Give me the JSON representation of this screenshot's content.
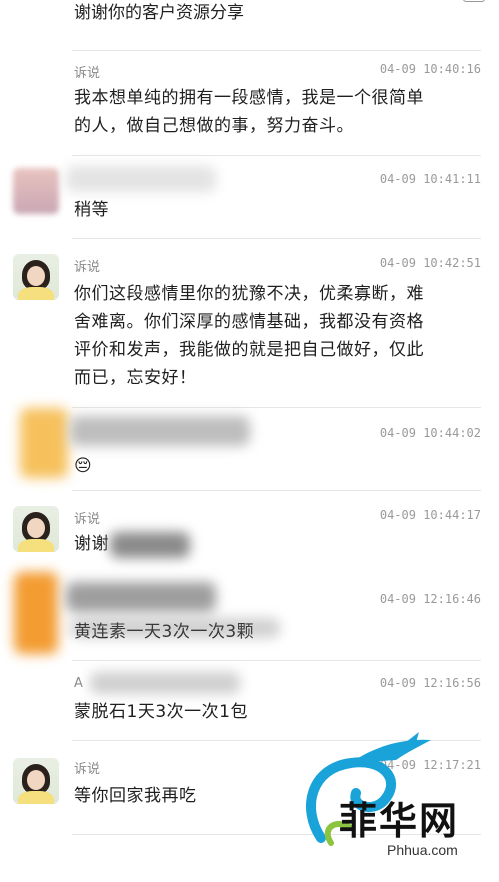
{
  "top_partial_text": "谢谢你的客户资源分享",
  "messages": [
    {
      "name": "诉说",
      "time": "04-09 10:40:16",
      "lines": [
        "我本想单纯的拥有一段感情，我是一个很简单",
        "的人，做自己想做的事，努力奋斗。"
      ]
    },
    {
      "name": "",
      "time": "04-09 10:41:11",
      "lines": [
        "稍等"
      ]
    },
    {
      "name": "诉说",
      "time": "04-09 10:42:51",
      "lines": [
        "你们这段感情里你的犹豫不决，优柔寡断，难",
        "舍难离。你们深厚的感情基础，我都没有资格",
        "评价和发声，我能做的就是把自己做好，仅此",
        "而已，忘安好！"
      ]
    },
    {
      "name": "",
      "time": "04-09 10:44:02",
      "lines": [
        "😔"
      ]
    },
    {
      "name": "诉说",
      "time": "04-09 10:44:17",
      "lines": [
        "谢谢"
      ]
    },
    {
      "name": "",
      "time": "04-09 12:16:46",
      "lines": [
        "黄连素一天3次一次3颗"
      ]
    },
    {
      "name": "A",
      "time": "04-09 12:16:56",
      "lines": [
        "蒙脱石1天3次一次1包"
      ]
    },
    {
      "name": "诉说",
      "time": "04-09 12:17:21",
      "lines": [
        "等你回家我再吃"
      ]
    }
  ],
  "watermark": {
    "title": "菲华网",
    "domain": "Phhua.com",
    "color_primary": "#1aa3d9",
    "color_secondary": "#8bc53f"
  }
}
